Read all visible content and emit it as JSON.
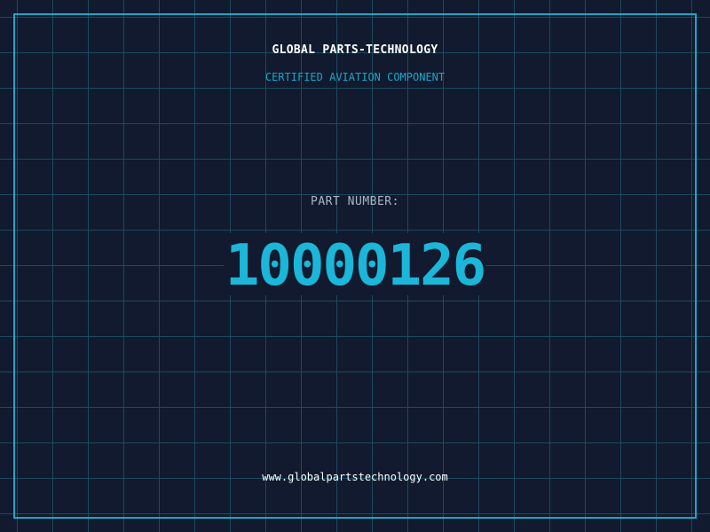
{
  "header": {
    "title": "GLOBAL PARTS-TECHNOLOGY",
    "subtitle": "CERTIFIED AVIATION COMPONENT"
  },
  "part": {
    "label": "PART NUMBER:",
    "number": "10000126"
  },
  "footer": {
    "website": "www.globalpartstechnology.com"
  },
  "colors": {
    "background": "#111a2e",
    "grid": "#1d4a5f",
    "accent": "#1aa7c9",
    "title": "#ffffff",
    "label": "#a9b6c6"
  }
}
